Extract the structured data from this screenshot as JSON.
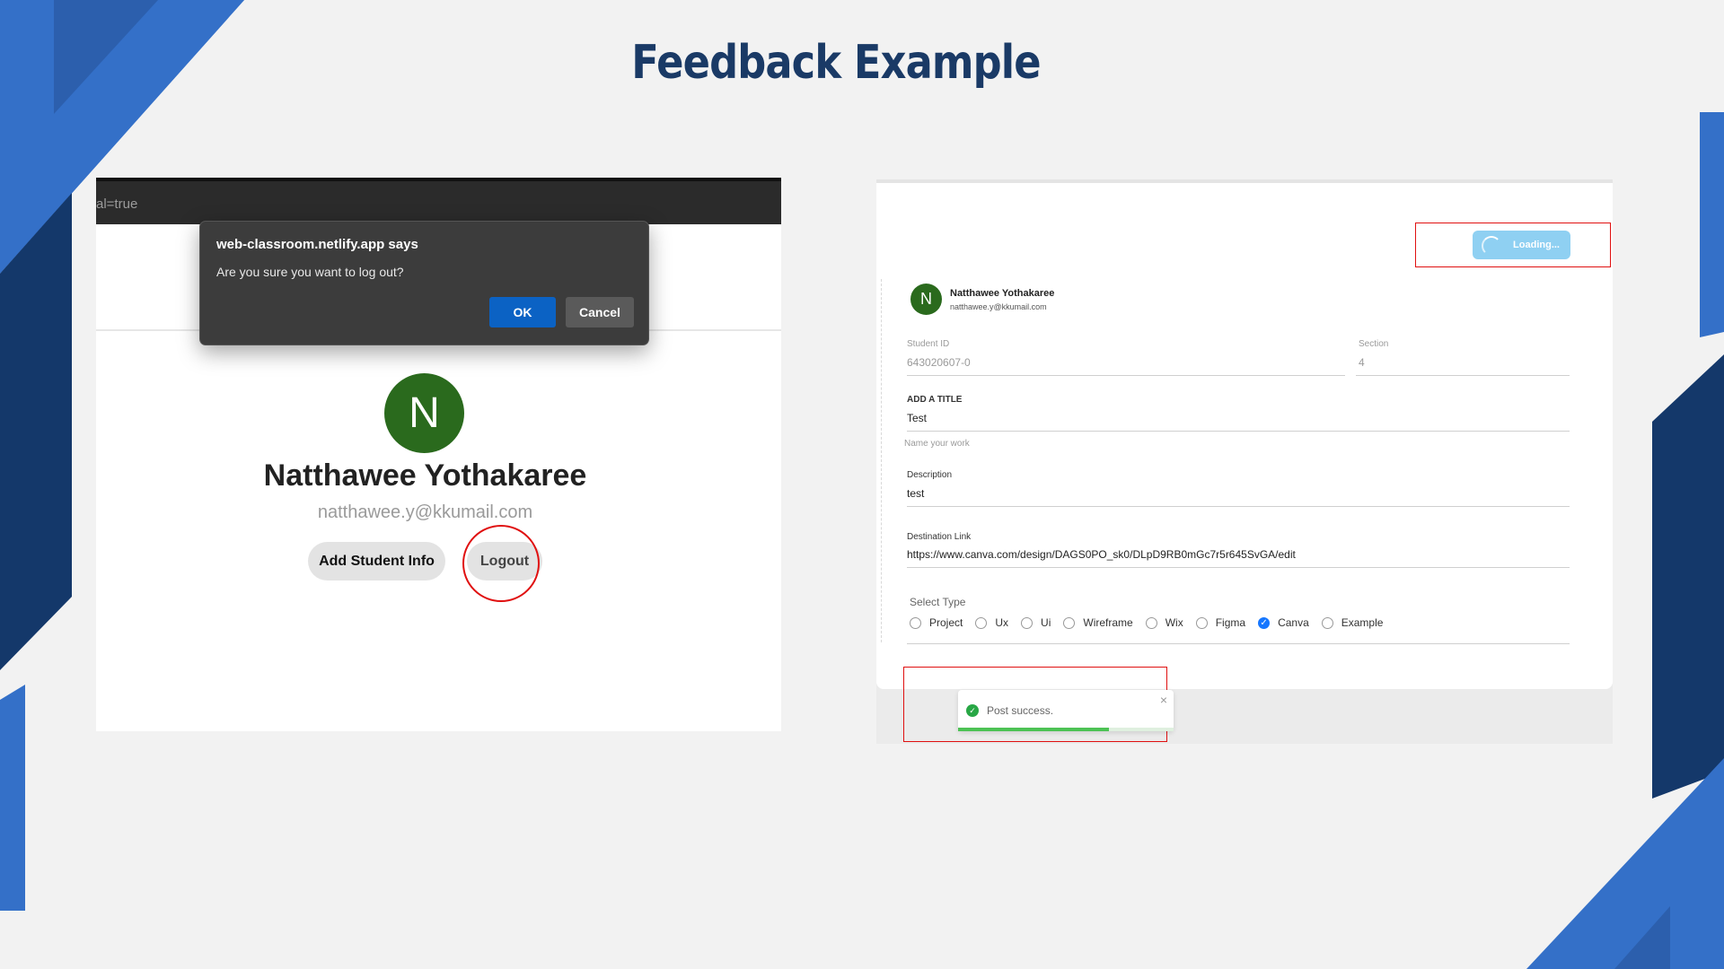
{
  "slide": {
    "title": "Feedback Example",
    "accent_color": "#1a3a66",
    "decor_colors": [
      "#3470c8",
      "#14386a",
      "#2c5fad"
    ]
  },
  "left_screenshot": {
    "url_fragment": "al=true",
    "dialog": {
      "title": "web-classroom.netlify.app says",
      "message": "Are you sure you want to log out?",
      "ok_label": "OK",
      "cancel_label": "Cancel"
    },
    "profile": {
      "initial": "N",
      "name": "Natthawee Yothakaree",
      "email": "natthawee.y@kkumail.com",
      "add_info_label": "Add Student Info",
      "logout_label": "Logout"
    }
  },
  "right_screenshot": {
    "loading_label": "Loading...",
    "user": {
      "initial": "N",
      "name": "Natthawee Yothakaree",
      "email": "natthawee.y@kkumail.com"
    },
    "fields": {
      "student_id_label": "Student ID",
      "student_id_value": "643020607-0",
      "section_label": "Section",
      "section_value": "4",
      "title_label": "ADD A TITLE",
      "title_value": "Test",
      "title_helper": "Name your work",
      "description_label": "Description",
      "description_value": "test",
      "destination_label": "Destination Link",
      "destination_value": "https://www.canva.com/design/DAGS0PO_sk0/DLpD9RB0mGc7r5r645SvGA/edit"
    },
    "select_type": {
      "label": "Select Type",
      "options": [
        {
          "label": "Project",
          "checked": false
        },
        {
          "label": "Ux",
          "checked": false
        },
        {
          "label": "Ui",
          "checked": false
        },
        {
          "label": "Wireframe",
          "checked": false
        },
        {
          "label": "Wix",
          "checked": false
        },
        {
          "label": "Figma",
          "checked": false
        },
        {
          "label": "Canva",
          "checked": true
        },
        {
          "label": "Example",
          "checked": false
        }
      ]
    },
    "toast": {
      "message": "Post success.",
      "close": "×",
      "progress": 0.7,
      "success_color": "#28a745"
    }
  }
}
